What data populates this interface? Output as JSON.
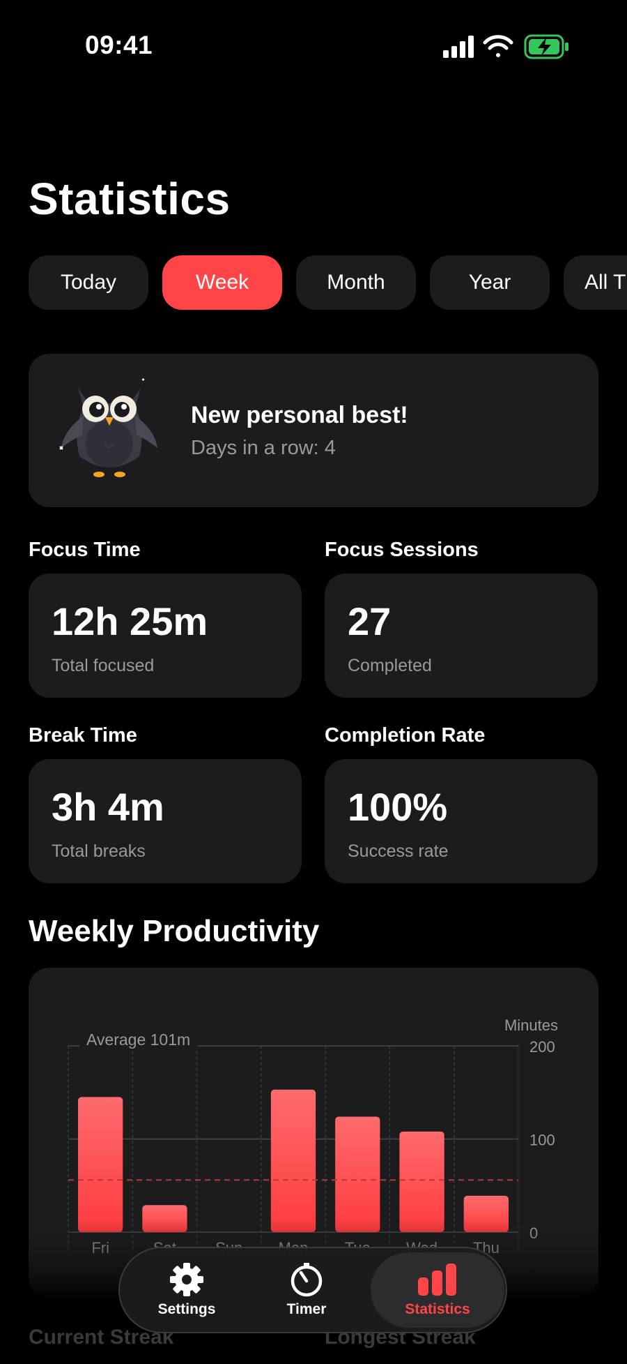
{
  "status_bar": {
    "time": "09:41"
  },
  "page": {
    "title": "Statistics"
  },
  "filters": {
    "active_index": 1,
    "items": [
      "Today",
      "Week",
      "Month",
      "Year",
      "All T"
    ]
  },
  "personal_best": {
    "title": "New personal best!",
    "subtitle": "Days in a row: 4"
  },
  "stats": {
    "focus_time": {
      "label": "Focus Time",
      "value": "12h 25m",
      "sub": "Total focused"
    },
    "focus_sessions": {
      "label": "Focus Sessions",
      "value": "27",
      "sub": "Completed"
    },
    "break_time": {
      "label": "Break Time",
      "value": "3h 4m",
      "sub": "Total breaks"
    },
    "completion_rate": {
      "label": "Completion Rate",
      "value": "100%",
      "sub": "Success rate"
    }
  },
  "weekly": {
    "title": "Weekly Productivity"
  },
  "chart_data": {
    "type": "bar",
    "categories": [
      "Fri",
      "Sat",
      "Sun",
      "Mon",
      "Tue",
      "Wed",
      "Thu"
    ],
    "values": [
      145,
      29,
      0,
      153,
      124,
      108,
      39
    ],
    "ylabel": "Minutes",
    "ylim": [
      0,
      200
    ],
    "yticks": [
      0,
      100,
      200
    ],
    "average": {
      "label": "Average 101m",
      "value": 56
    },
    "colors": {
      "bar_top": "#ff6b6d",
      "bar_bottom": "#ff3b3e",
      "average_line": "#b33a3b"
    }
  },
  "below_fold": {
    "left": "Current Streak",
    "right": "Longest Streak"
  },
  "tab_bar": {
    "items": [
      {
        "label": "Settings",
        "icon": "gear-icon"
      },
      {
        "label": "Timer",
        "icon": "timer-icon"
      },
      {
        "label": "Statistics",
        "icon": "bar-chart-icon"
      }
    ],
    "active_index": 2,
    "active_color": "#ff4547"
  }
}
